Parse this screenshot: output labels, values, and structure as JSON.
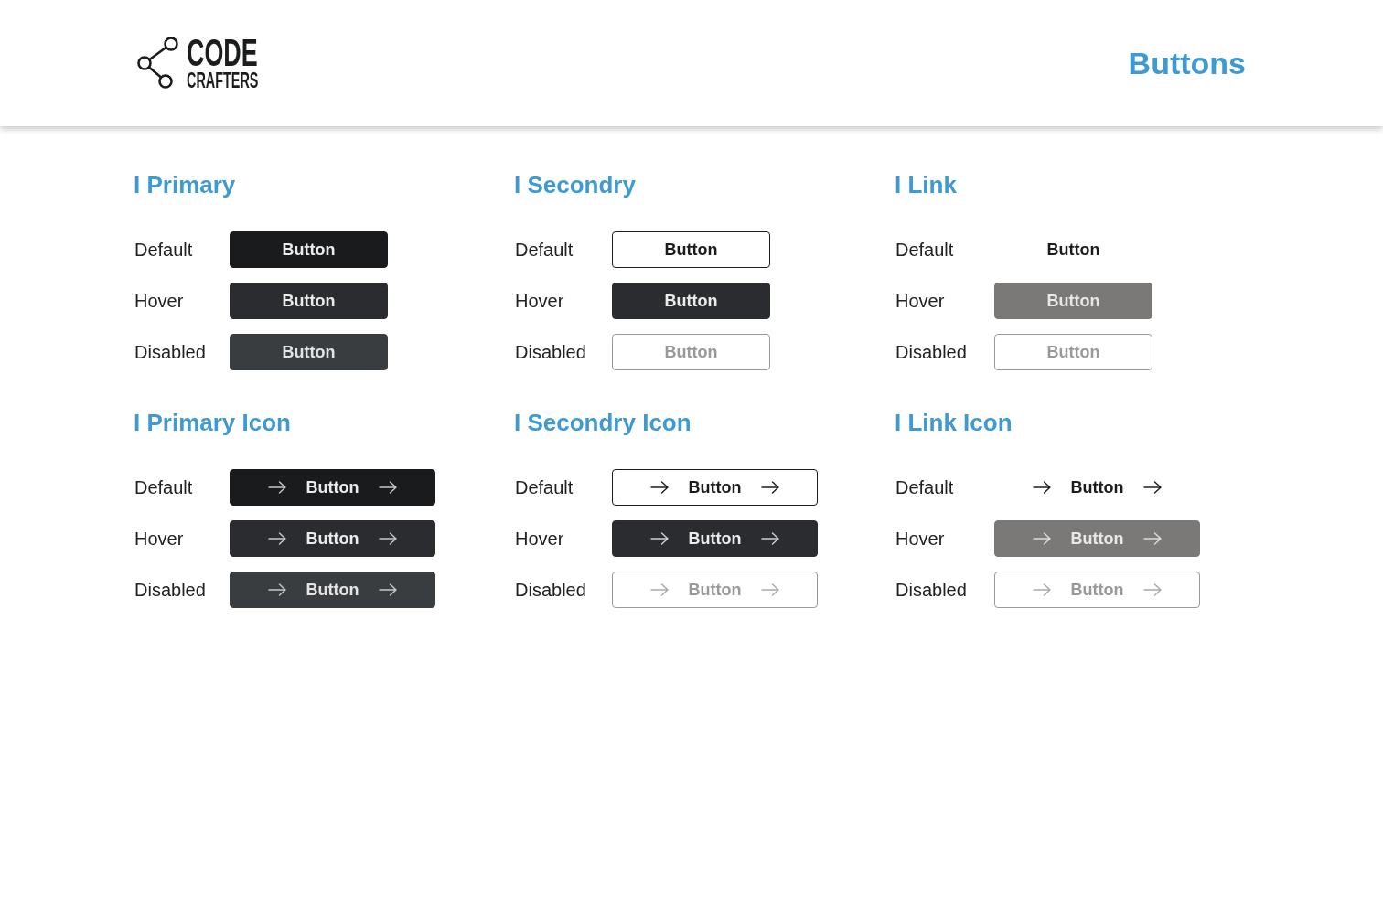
{
  "header": {
    "logo": {
      "word_1": "CODE",
      "word_2": "CRAFTERS"
    },
    "title": "Buttons"
  },
  "sections": [
    {
      "title": "I Primary",
      "kind": "primary",
      "icons": false,
      "rows": [
        {
          "label": "Default",
          "kind": "default",
          "button": "Button"
        },
        {
          "label": "Hover",
          "kind": "hover",
          "button": "Button"
        },
        {
          "label": "Disabled",
          "kind": "disabled",
          "button": "Button"
        }
      ]
    },
    {
      "title": "I Secondry",
      "kind": "secondary",
      "icons": false,
      "rows": [
        {
          "label": "Default",
          "kind": "default",
          "button": "Button"
        },
        {
          "label": "Hover",
          "kind": "hover",
          "button": "Button"
        },
        {
          "label": "Disabled",
          "kind": "disabled",
          "button": "Button"
        }
      ]
    },
    {
      "title": "I Link",
      "kind": "link",
      "icons": false,
      "rows": [
        {
          "label": "Default",
          "kind": "default",
          "button": "Button"
        },
        {
          "label": "Hover",
          "kind": "hover",
          "button": "Button"
        },
        {
          "label": "Disabled",
          "kind": "disabled",
          "button": "Button"
        }
      ]
    },
    {
      "title": "I Primary Icon",
      "kind": "primary",
      "icons": true,
      "rows": [
        {
          "label": "Default",
          "kind": "default",
          "button": "Button"
        },
        {
          "label": "Hover",
          "kind": "hover",
          "button": "Button"
        },
        {
          "label": "Disabled",
          "kind": "disabled",
          "button": "Button"
        }
      ]
    },
    {
      "title": "I Secondry Icon",
      "kind": "secondary",
      "icons": true,
      "rows": [
        {
          "label": "Default",
          "kind": "default",
          "button": "Button"
        },
        {
          "label": "Hover",
          "kind": "hover",
          "button": "Button"
        },
        {
          "label": "Disabled",
          "kind": "disabled",
          "button": "Button"
        }
      ]
    },
    {
      "title": "I Link Icon",
      "kind": "link",
      "icons": true,
      "rows": [
        {
          "label": "Default",
          "kind": "default",
          "button": "Button"
        },
        {
          "label": "Hover",
          "kind": "hover",
          "button": "Button"
        },
        {
          "label": "Disabled",
          "kind": "disabled",
          "button": "Button"
        }
      ]
    }
  ]
}
